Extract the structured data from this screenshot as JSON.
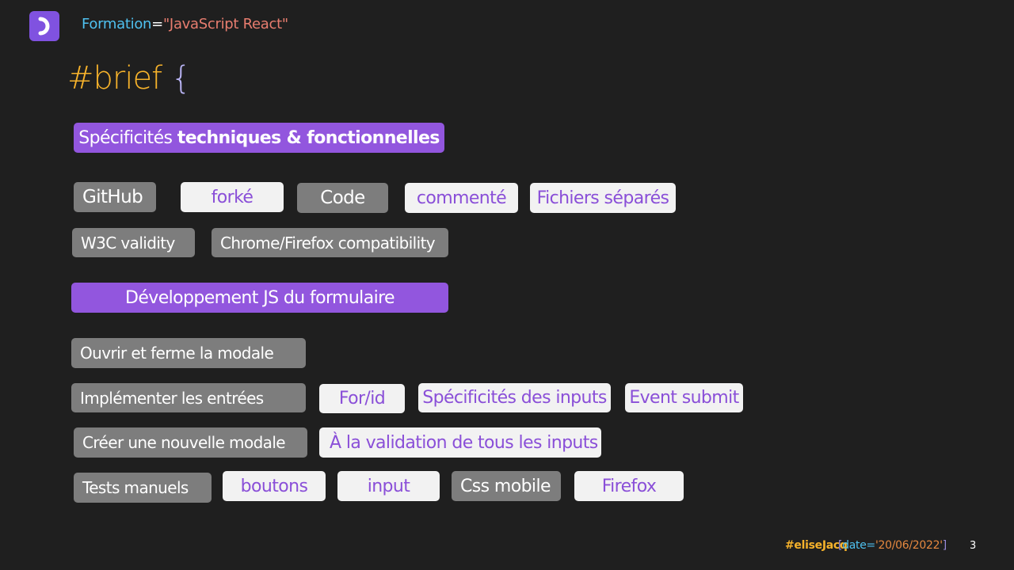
{
  "header": {
    "key": "Formation",
    "eq": "=",
    "value": "\"JavaScript React\""
  },
  "title": {
    "word": "#brief",
    "brace": "{"
  },
  "section1": {
    "label_plain": "Spécificités ",
    "label_bold": "techniques & fonctionnelles"
  },
  "row1": [
    "GitHub",
    "forké",
    "Code",
    "commenté",
    "Fichiers séparés"
  ],
  "row2": [
    "W3C validity",
    "Chrome/Firefox compatibility"
  ],
  "section2": {
    "label": "Développement JS du formulaire"
  },
  "row3": [
    "Ouvrir et ferme la modale"
  ],
  "row4": [
    "Implémenter les entrées",
    "For/id",
    "Spécificités des inputs",
    "Event submit"
  ],
  "row5": [
    "Créer une nouvelle modale",
    "À la validation de tous les inputs"
  ],
  "row6": [
    "Tests manuels",
    "boutons",
    "input",
    "Css mobile",
    "Firefox"
  ],
  "footer": {
    "name": "#eliseJacq",
    "bracket_open": "[",
    "date_key": "date=",
    "date_value": "'20/06/2022'",
    "bracket_close": "]",
    "page_number": "3"
  },
  "colors": {
    "background": "#1f1f1f",
    "purple": "#9256de",
    "gray": "#7d7d7d",
    "white_pill": "#f2f2f2",
    "accent_yellow": "#f6b22b",
    "accent_blue": "#4fc1f0"
  },
  "icons": {
    "logo": "logo-icon"
  }
}
